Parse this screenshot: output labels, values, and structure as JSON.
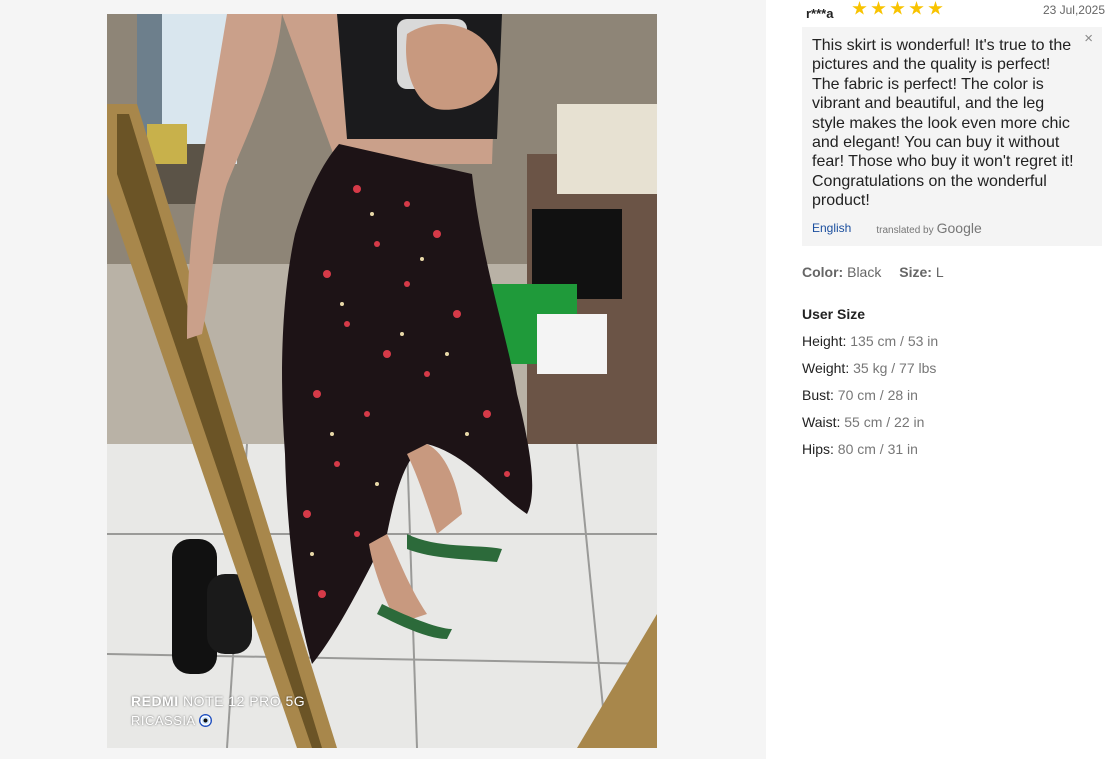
{
  "photo": {
    "watermark_brand": "REDMI",
    "watermark_model": "NOTE 12 PRO 5G",
    "watermark_user": "RICASSIA"
  },
  "review": {
    "reviewer": "r***a",
    "rating": 5,
    "date": "23 Jul,2025",
    "text": "This skirt is wonderful! It's true to the pictures and the quality is perfect! The fabric is perfect! The color is vibrant and beautiful, and the leg style makes the look even more chic and elegant! You can buy it without fear! Those who buy it won't regret it! Congratulations on the wonderful product!",
    "close_icon": "×",
    "translation_language": "English",
    "translated_by": "translated by",
    "translator": "Google"
  },
  "sku": {
    "color_label": "Color:",
    "color_value": "Black",
    "size_label": "Size:",
    "size_value": "L"
  },
  "user_size": {
    "title": "User Size",
    "rows": [
      {
        "label": "Height:",
        "value": "135 cm / 53 in"
      },
      {
        "label": "Weight:",
        "value": "35 kg / 77 lbs"
      },
      {
        "label": "Bust:",
        "value": "70 cm / 28 in"
      },
      {
        "label": "Waist:",
        "value": "55 cm / 22 in"
      },
      {
        "label": "Hips:",
        "value": "80 cm / 31 in"
      }
    ]
  },
  "colors": {
    "star": "#f8c300",
    "review_bg": "#f4f4f4",
    "link": "#1a4e9e"
  }
}
